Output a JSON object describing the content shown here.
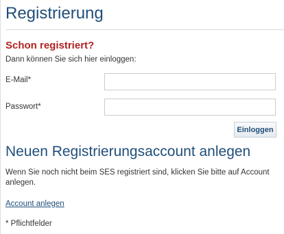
{
  "header": {
    "title": "Registrierung"
  },
  "login": {
    "heading": "Schon registriert?",
    "hint": "Dann können Sie sich hier einloggen:",
    "email_label": "E-Mail*",
    "email_value": "",
    "password_label": "Passwort*",
    "password_value": "",
    "submit_label": "Einloggen"
  },
  "register": {
    "heading": "Neuen Registrierungsaccount anlegen",
    "text": "Wenn Sie noch nicht beim SES registriert sind, klicken Sie bitte auf Account anlegen.",
    "link_label": "Account anlegen"
  },
  "footer": {
    "required_note": "* Pflichtfelder"
  },
  "colors": {
    "title_blue": "#1f4e79",
    "heading_red": "#b22222",
    "text_gray": "#333333"
  }
}
